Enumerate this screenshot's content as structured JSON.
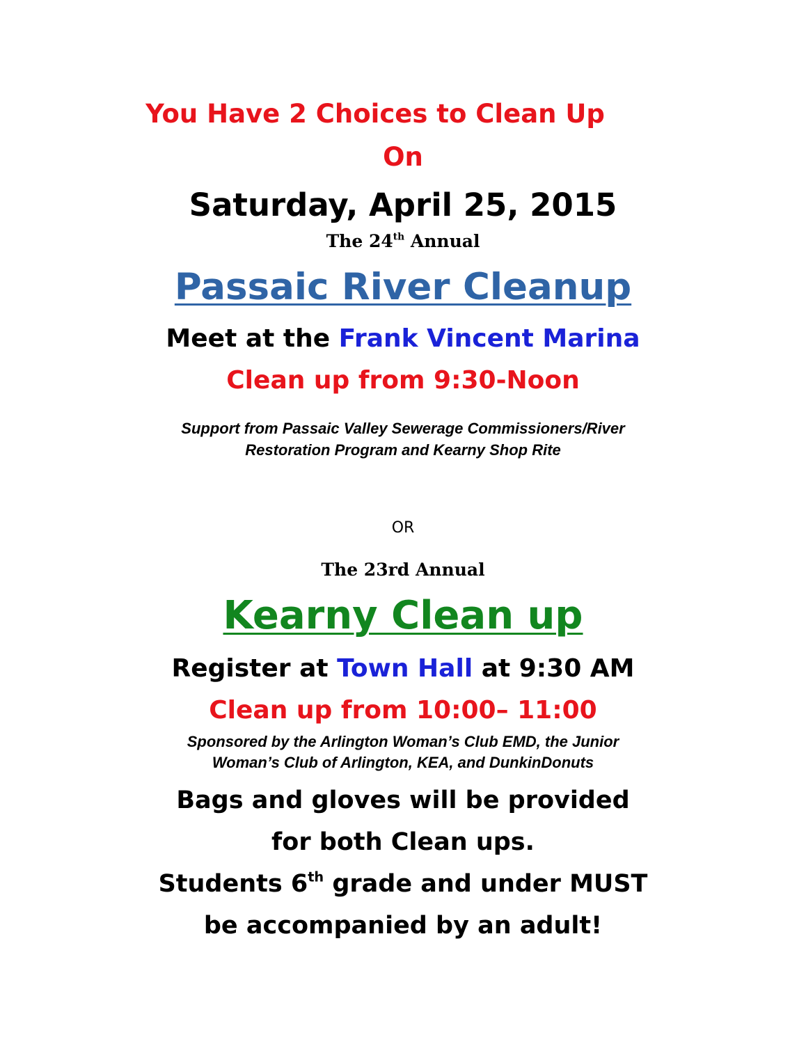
{
  "headline": {
    "line1": "You Have 2 Choices to Clean Up",
    "line2": "On",
    "date": "Saturday, April 25, 2015"
  },
  "passaic": {
    "annual_prefix": "The 24",
    "annual_sup": "th",
    "annual_suffix": " Annual",
    "title": "Passaic River Cleanup",
    "meet_prefix": "Meet at the ",
    "meet_place": "Frank Vincent Marina",
    "time": "Clean up from 9:30-Noon",
    "support_line1": "Support from Passaic Valley Sewerage Commissioners/River",
    "support_line2": "Restoration Program and Kearny Shop Rite"
  },
  "or_text": "OR",
  "kearny": {
    "annual": "The 23rd Annual",
    "title": "Kearny Clean up",
    "register_prefix": "Register at ",
    "register_place": "Town Hall",
    "register_suffix": " at 9:30 AM",
    "time": "Clean up from 10:00– 11:00",
    "sponsor_line1": "Sponsored by the Arlington Woman’s Club EMD, the Junior",
    "sponsor_line2": "Woman’s Club of Arlington, KEA, and DunkinDonuts"
  },
  "closing": {
    "line1": "Bags and gloves will be provided",
    "line2": "for both Clean ups.",
    "line3_prefix": "Students 6",
    "line3_sup": "th",
    "line3_suffix": " grade and under MUST",
    "line4": "be accompanied by an adult!"
  },
  "colors": {
    "red": "#e8141c",
    "blue": "#1a22d8",
    "steel_blue": "#2f64a6",
    "green": "#12861f"
  }
}
